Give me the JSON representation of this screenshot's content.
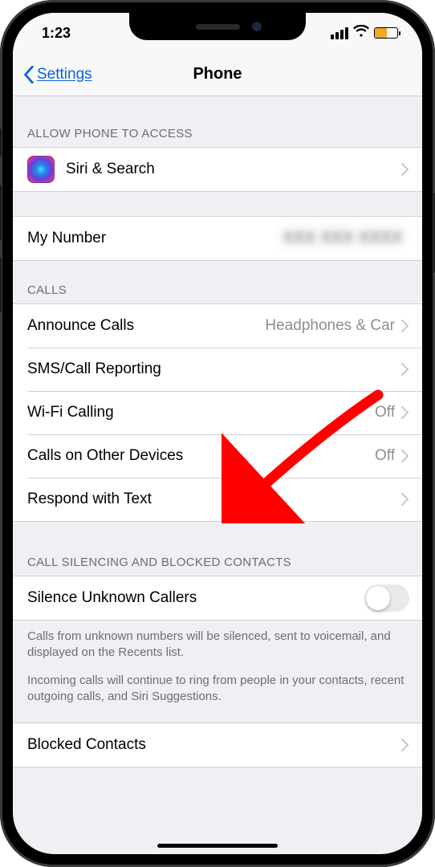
{
  "status": {
    "time": "1:23"
  },
  "nav": {
    "back": "Settings",
    "title": "Phone"
  },
  "sections": {
    "access": {
      "header": "ALLOW PHONE TO ACCESS",
      "siri": "Siri & Search"
    },
    "myNumber": {
      "label": "My Number",
      "value": "XXX XXX XXXX"
    },
    "calls": {
      "header": "CALLS",
      "announce": {
        "label": "Announce Calls",
        "value": "Headphones & Car"
      },
      "sms": {
        "label": "SMS/Call Reporting"
      },
      "wifi": {
        "label": "Wi-Fi Calling",
        "value": "Off"
      },
      "otherDevices": {
        "label": "Calls on Other Devices",
        "value": "Off"
      },
      "respond": {
        "label": "Respond with Text"
      }
    },
    "silencing": {
      "header": "CALL SILENCING AND BLOCKED CONTACTS",
      "silence": {
        "label": "Silence Unknown Callers",
        "on": false
      },
      "footer1": "Calls from unknown numbers will be silenced, sent to voicemail, and displayed on the Recents list.",
      "footer2": "Incoming calls will continue to ring from people in your contacts, recent outgoing calls, and Siri Suggestions.",
      "blocked": "Blocked Contacts"
    }
  }
}
